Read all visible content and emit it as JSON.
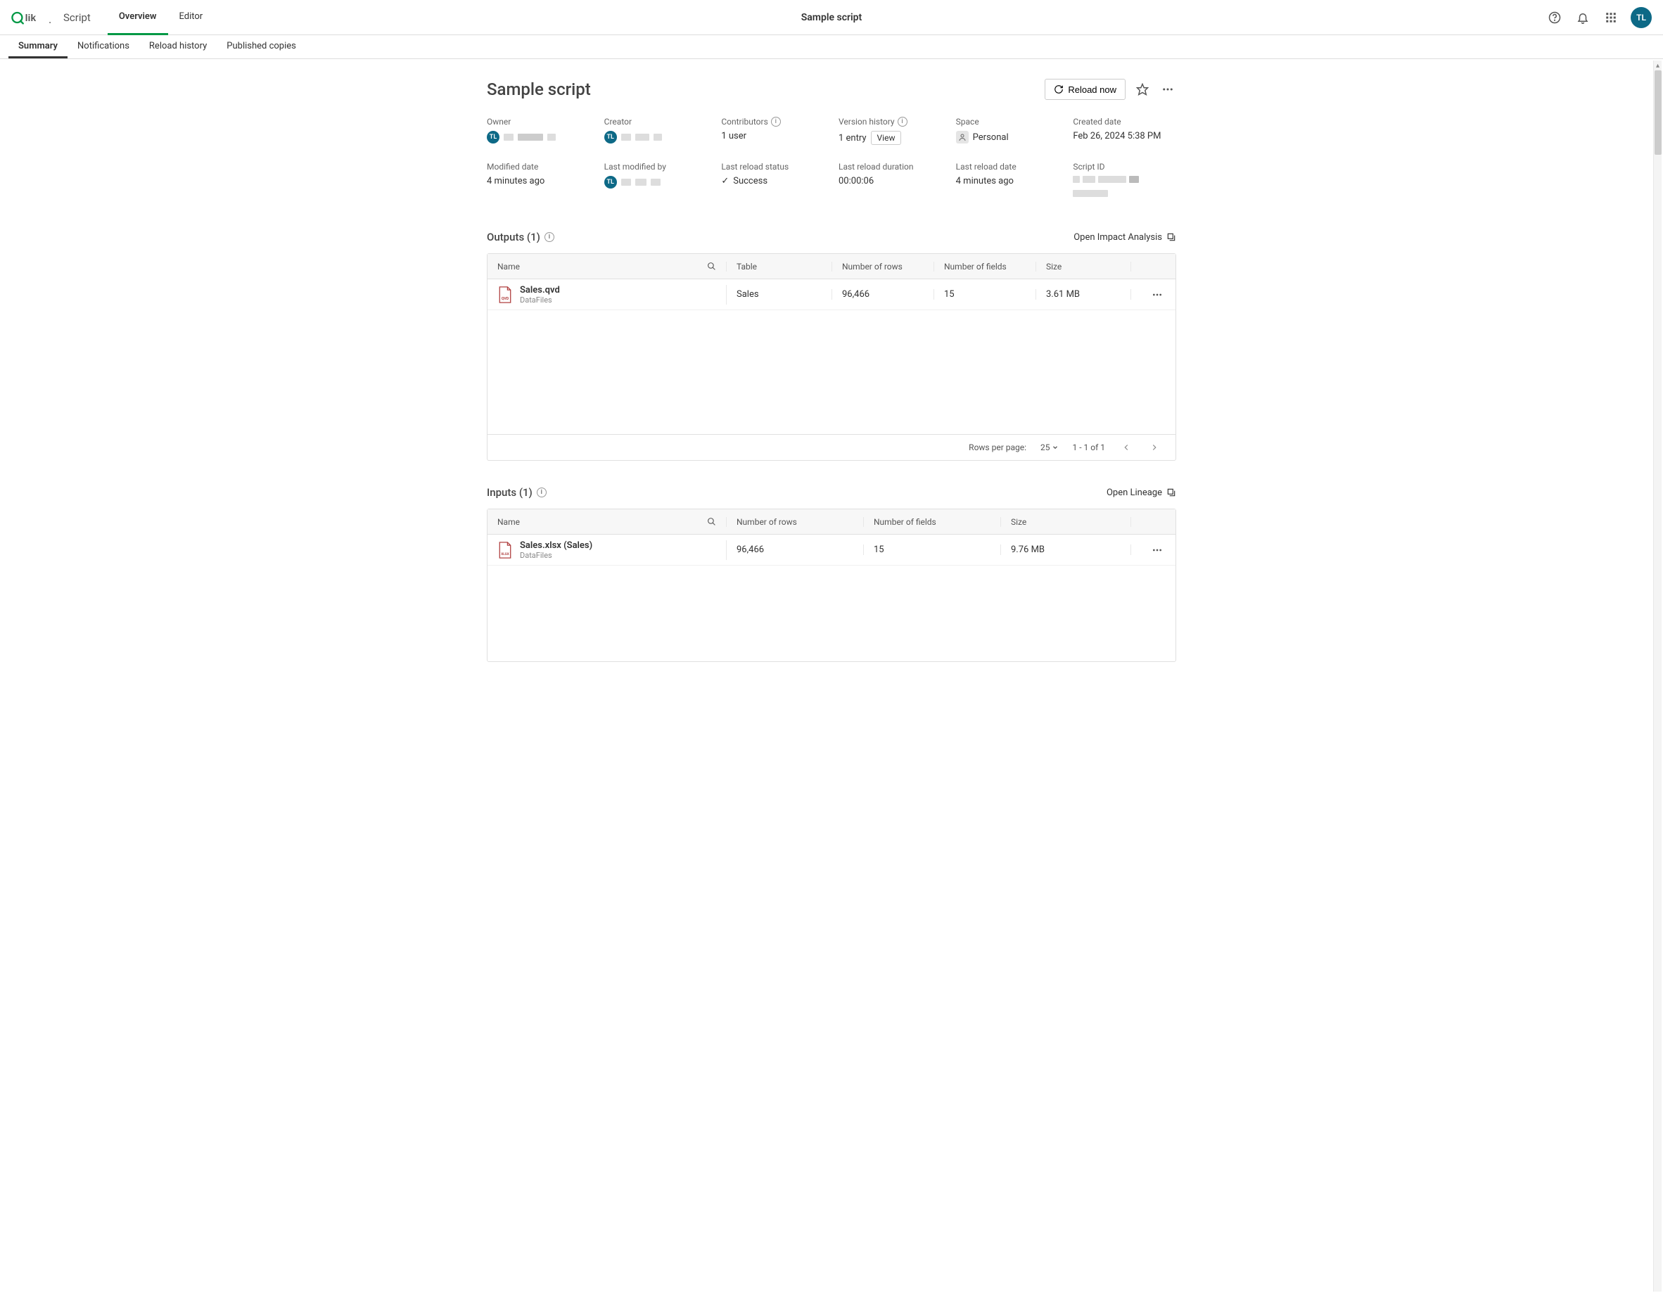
{
  "topbar": {
    "script_label": "Script",
    "nav": [
      {
        "label": "Overview",
        "active": true
      },
      {
        "label": "Editor",
        "active": false
      }
    ],
    "title": "Sample script",
    "user_initials": "TL"
  },
  "subtabs": [
    {
      "label": "Summary",
      "active": true
    },
    {
      "label": "Notifications",
      "active": false
    },
    {
      "label": "Reload history",
      "active": false
    },
    {
      "label": "Published copies",
      "active": false
    }
  ],
  "page": {
    "title": "Sample script",
    "reload_label": "Reload now"
  },
  "details": {
    "owner": {
      "label": "Owner",
      "initials": "TL"
    },
    "creator": {
      "label": "Creator",
      "initials": "TL"
    },
    "contributors": {
      "label": "Contributors",
      "value": "1 user"
    },
    "version_history": {
      "label": "Version history",
      "value": "1 entry",
      "view": "View"
    },
    "space": {
      "label": "Space",
      "value": "Personal"
    },
    "created_date": {
      "label": "Created date",
      "value": "Feb 26, 2024 5:38 PM"
    },
    "modified_date": {
      "label": "Modified date",
      "value": "4 minutes ago"
    },
    "last_modified_by": {
      "label": "Last modified by",
      "initials": "TL"
    },
    "last_reload_status": {
      "label": "Last reload status",
      "value": "Success"
    },
    "last_reload_duration": {
      "label": "Last reload duration",
      "value": "00:00:06"
    },
    "last_reload_date": {
      "label": "Last reload date",
      "value": "4 minutes ago"
    },
    "script_id": {
      "label": "Script ID"
    }
  },
  "outputs": {
    "title": "Outputs (1)",
    "link": "Open Impact Analysis",
    "columns": {
      "name": "Name",
      "table": "Table",
      "rows": "Number of rows",
      "fields": "Number of fields",
      "size": "Size"
    },
    "rows": [
      {
        "name": "Sales.qvd",
        "source": "DataFiles",
        "table": "Sales",
        "num_rows": "96,466",
        "num_fields": "15",
        "size": "3.61 MB",
        "file_type": "QVD"
      }
    ],
    "pagination": {
      "rows_per_page_label": "Rows per page:",
      "rows_per_page_value": "25",
      "range": "1 - 1 of 1"
    }
  },
  "inputs": {
    "title": "Inputs (1)",
    "link": "Open Lineage",
    "columns": {
      "name": "Name",
      "rows": "Number of rows",
      "fields": "Number of fields",
      "size": "Size"
    },
    "rows": [
      {
        "name": "Sales.xlsx (Sales)",
        "source": "DataFiles",
        "num_rows": "96,466",
        "num_fields": "15",
        "size": "9.76 MB",
        "file_type": "XLSX"
      }
    ]
  }
}
